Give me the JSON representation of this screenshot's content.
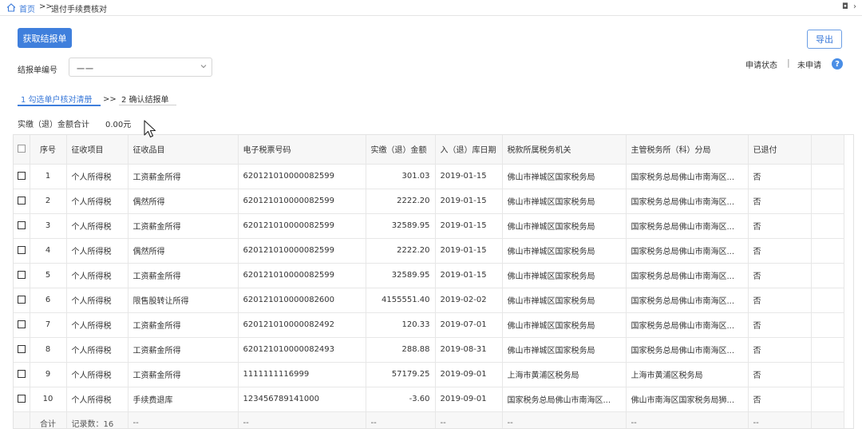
{
  "breadcrumb": {
    "home": "首页",
    "separator": ">>",
    "current": "退付手续费核对"
  },
  "window": {
    "restore_symbol": "◘",
    "more_symbol": "›"
  },
  "toolbar": {
    "fetch_label": "获取结报单",
    "export_label": "导出"
  },
  "status": {
    "label": "申请状态",
    "divider": "|",
    "value": "未申请",
    "help_symbol": "?"
  },
  "report_select": {
    "label": "结报单编号",
    "value": "一一"
  },
  "steps": [
    {
      "label": "1 勾选单户核对清册"
    },
    {
      "label": "2 确认结报单"
    }
  ],
  "step_separator": ">>",
  "summary": {
    "label": "实缴（退）金额合计",
    "value": "0.00元"
  },
  "table": {
    "columns": [
      "序号",
      "征收项目",
      "征收品目",
      "电子税票号码",
      "实缴（退）金额",
      "入（退）库日期",
      "税款所属税务机关",
      "主管税务所（科）分局",
      "已退付"
    ],
    "rows": [
      [
        "1",
        "个人所得税",
        "工资薪金所得",
        "620121010000082599",
        "301.03",
        "2019-01-15",
        "佛山市禅城区国家税务局",
        "国家税务总局佛山市南海区...",
        "否"
      ],
      [
        "2",
        "个人所得税",
        "偶然所得",
        "620121010000082599",
        "2222.20",
        "2019-01-15",
        "佛山市禅城区国家税务局",
        "国家税务总局佛山市南海区...",
        "否"
      ],
      [
        "3",
        "个人所得税",
        "工资薪金所得",
        "620121010000082599",
        "32589.95",
        "2019-01-15",
        "佛山市禅城区国家税务局",
        "国家税务总局佛山市南海区...",
        "否"
      ],
      [
        "4",
        "个人所得税",
        "偶然所得",
        "620121010000082599",
        "2222.20",
        "2019-01-15",
        "佛山市禅城区国家税务局",
        "国家税务总局佛山市南海区...",
        "否"
      ],
      [
        "5",
        "个人所得税",
        "工资薪金所得",
        "620121010000082599",
        "32589.95",
        "2019-01-15",
        "佛山市禅城区国家税务局",
        "国家税务总局佛山市南海区...",
        "否"
      ],
      [
        "6",
        "个人所得税",
        "限售股转让所得",
        "620121010000082600",
        "4155551.40",
        "2019-02-02",
        "佛山市禅城区国家税务局",
        "国家税务总局佛山市南海区...",
        "否"
      ],
      [
        "7",
        "个人所得税",
        "工资薪金所得",
        "620121010000082492",
        "120.33",
        "2019-07-01",
        "佛山市禅城区国家税务局",
        "国家税务总局佛山市南海区...",
        "否"
      ],
      [
        "8",
        "个人所得税",
        "工资薪金所得",
        "620121010000082493",
        "288.88",
        "2019-08-31",
        "佛山市禅城区国家税务局",
        "国家税务总局佛山市南海区...",
        "否"
      ],
      [
        "9",
        "个人所得税",
        "工资薪金所得",
        "1111111116999",
        "57179.25",
        "2019-09-01",
        "上海市黄浦区税务局",
        "上海市黄浦区税务局",
        "否"
      ],
      [
        "10",
        "个人所得税",
        "手续费退库",
        "123456789141000",
        "-3.60",
        "2019-09-01",
        "国家税务总局佛山市南海区...",
        "佛山市南海区国家税务局狮...",
        "否"
      ]
    ],
    "footer": {
      "total_label": "合计",
      "record_count": "记录数：16",
      "placeholder": "--"
    }
  },
  "colors": {
    "accent": "#3f7fdc",
    "link": "#3a79d9"
  }
}
